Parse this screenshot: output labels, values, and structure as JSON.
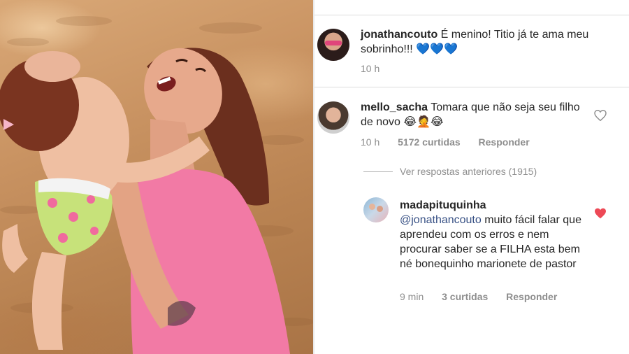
{
  "photo": {
    "description_icon": "photo-image"
  },
  "comments": [
    {
      "username": "jonathancouto",
      "text": "É menino! Titio já te ama meu sobrinho!!! 💙💙💙",
      "time": "10 h"
    },
    {
      "username": "mello_sacha",
      "text": "Tomara que não seja seu filho de novo 😂🤦😂",
      "time": "10 h",
      "likes": "5172 curtidas",
      "reply": "Responder"
    }
  ],
  "view_previous": "Ver respostas anteriores (1915)",
  "reply_comment": {
    "username": "madapituquinha",
    "mention": "@jonathancouto",
    "text": " muito fácil falar que aprendeu com os erros e nem procurar saber se a FILHA esta bem né bonequinho marionete de pastor",
    "time": "9 min",
    "likes": "3 curtidas",
    "reply": "Responder"
  },
  "colors": {
    "heart_liked": "#ed4956",
    "heart_outline": "#8e8e8e",
    "text": "#262626",
    "meta": "#8e8e8e"
  }
}
